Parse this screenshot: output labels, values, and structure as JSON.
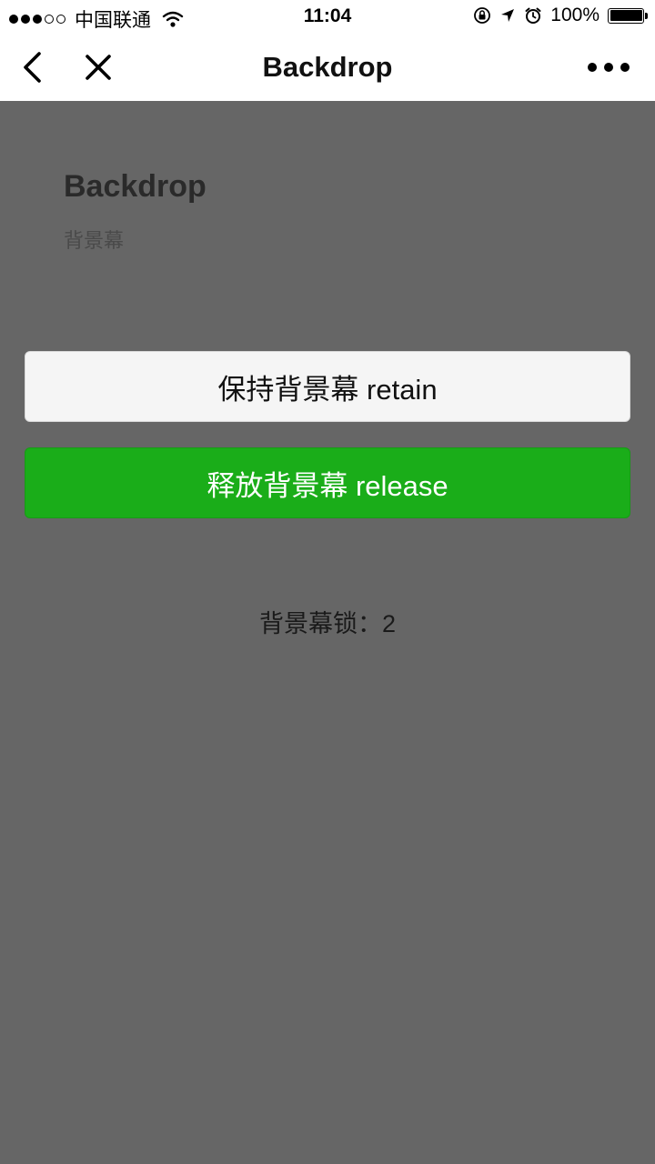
{
  "status_bar": {
    "carrier": "中国联通",
    "time": "11:04",
    "battery": "100%",
    "battery_level": 1.0,
    "signal_bars_filled": 3,
    "signal_bars_total": 5
  },
  "nav": {
    "title": "Backdrop",
    "icons": {
      "back": "chevron-left-icon",
      "close": "close-icon",
      "more": "more-dots-icon"
    }
  },
  "page": {
    "title": "Backdrop",
    "desc": "背景幕"
  },
  "buttons": {
    "retain": "保持背景幕 retain",
    "release": "释放背景幕 release"
  },
  "lock": {
    "text": "背景幕锁：2"
  },
  "colors": {
    "backdrop": "#666666",
    "primary_button": "#1aad19",
    "default_button": "#f5f5f5"
  }
}
